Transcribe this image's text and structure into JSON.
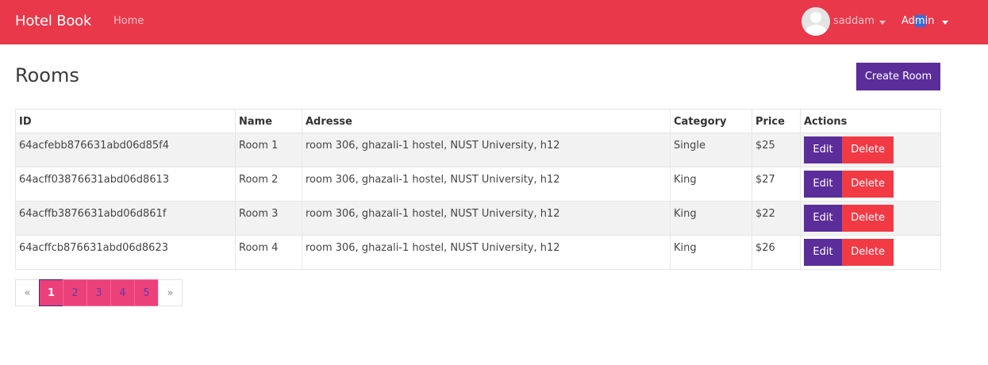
{
  "navbar": {
    "brand": "Hotel Book",
    "home": "Home",
    "user_name": "saddam",
    "admin_pre": "Ad",
    "admin_sel": "m",
    "admin_post": "in"
  },
  "header": {
    "title": "Rooms",
    "create_label": "Create Room"
  },
  "table": {
    "columns": [
      "ID",
      "Name",
      "Adresse",
      "Category",
      "Price",
      "Actions"
    ],
    "rows": [
      {
        "id": "64acfebb876631abd06d85f4",
        "name": "Room 1",
        "address": "room 306, ghazali-1 hostel, NUST University, h12",
        "category": "Single",
        "price": "$25"
      },
      {
        "id": "64acff03876631abd06d8613",
        "name": "Room 2",
        "address": "room 306, ghazali-1 hostel, NUST University, h12",
        "category": "King",
        "price": "$27"
      },
      {
        "id": "64acffb3876631abd06d861f",
        "name": "Room 3",
        "address": "room 306, ghazali-1 hostel, NUST University, h12",
        "category": "King",
        "price": "$22"
      },
      {
        "id": "64acffcb876631abd06d8623",
        "name": "Room 4",
        "address": "room 306, ghazali-1 hostel, NUST University, h12",
        "category": "King",
        "price": "$26"
      }
    ],
    "edit_label": "Edit",
    "delete_label": "Delete"
  },
  "pagination": {
    "prev": "«",
    "pages": [
      "1",
      "2",
      "3",
      "4",
      "5"
    ],
    "next": "»",
    "active_page": "1"
  },
  "colors": {
    "navbar": "#e8384a",
    "primary": "#5b2d9a",
    "danger": "#f23a45",
    "page_pink": "#ec407a"
  }
}
